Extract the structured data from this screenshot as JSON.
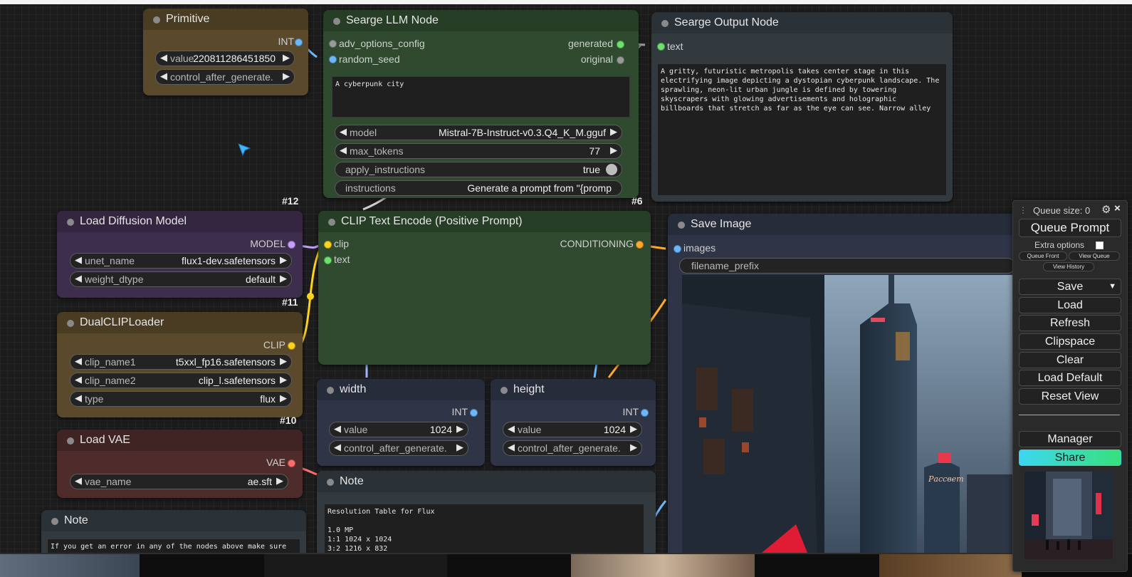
{
  "nodes": {
    "primitive": {
      "title": "Primitive",
      "output": "INT",
      "widgets": [
        {
          "label": "value",
          "value": "220811286451850"
        },
        {
          "label": "control_after_generate.",
          "value": ""
        }
      ]
    },
    "llm": {
      "title": "Searge LLM Node",
      "id": "#6",
      "inputs": [
        "adv_options_config",
        "random_seed"
      ],
      "outputs": [
        "generated",
        "original"
      ],
      "prompt_text": "A cyberpunk city",
      "widgets": [
        {
          "label": "model",
          "value": "Mistral-7B-Instruct-v0.3.Q4_K_M.gguf"
        },
        {
          "label": "max_tokens",
          "value": "77"
        },
        {
          "label": "apply_instructions",
          "value": "true"
        },
        {
          "label": "instructions",
          "value": "Generate a prompt from \"{promp"
        }
      ]
    },
    "output": {
      "title": "Searge Output Node",
      "input": "text",
      "text": "A gritty, futuristic metropolis takes center stage in this electrifying image depicting a dystopian cyberpunk landscape. The sprawling, neon-lit urban jungle is defined by towering skyscrapers with glowing advertisements and holographic billboards that stretch as far as the eye can see. Narrow alley"
    },
    "load_diffusion": {
      "title": "Load Diffusion Model",
      "id": "#12",
      "output": "MODEL",
      "widgets": [
        {
          "label": "unet_name",
          "value": "flux1-dev.safetensors"
        },
        {
          "label": "weight_dtype",
          "value": "default"
        }
      ]
    },
    "dualclip": {
      "title": "DualCLIPLoader",
      "id": "#11",
      "output": "CLIP",
      "widgets": [
        {
          "label": "clip_name1",
          "value": "t5xxl_fp16.safetensors"
        },
        {
          "label": "clip_name2",
          "value": "clip_l.safetensors"
        },
        {
          "label": "type",
          "value": "flux"
        }
      ]
    },
    "loadvae": {
      "title": "Load VAE",
      "id": "#10",
      "output": "VAE",
      "widgets": [
        {
          "label": "vae_name",
          "value": "ae.sft"
        }
      ]
    },
    "note_left": {
      "title": "Note",
      "text": "If you get an error in any of the nodes above make sure"
    },
    "clip_encode": {
      "title": "CLIP Text Encode (Positive Prompt)",
      "inputs": [
        "clip",
        "text"
      ],
      "output": "CONDITIONING"
    },
    "width": {
      "title": "width",
      "output": "INT",
      "widgets": [
        {
          "label": "value",
          "value": "1024"
        },
        {
          "label": "control_after_generate.",
          "value": ""
        }
      ]
    },
    "height": {
      "title": "height",
      "output": "INT",
      "widgets": [
        {
          "label": "value",
          "value": "1024"
        },
        {
          "label": "control_after_generate.",
          "value": ""
        }
      ]
    },
    "note_mid": {
      "title": "Note",
      "text": "Resolution Table for Flux\n\n1.0 MP\n1:1 1024 x 1024\n3:2 1216 x 832"
    },
    "save_image": {
      "title": "Save Image",
      "input": "images",
      "widget": "filename_prefix"
    }
  },
  "queue_panel": {
    "queue_size": "Queue size: 0",
    "queue_prompt": "Queue Prompt",
    "extra_options": "Extra options",
    "queue_front": "Queue Front",
    "view_queue": "View Queue",
    "view_history": "View History",
    "save": "Save",
    "save_dropdown": "▼",
    "load": "Load",
    "refresh": "Refresh",
    "clipspace": "Clipspace",
    "clear": "Clear",
    "load_default": "Load Default",
    "reset_view": "Reset View",
    "manager": "Manager",
    "share": "Share"
  },
  "colors": {
    "green_node": "#2f4a2f",
    "purple_node": "#3e2e4d",
    "brown_node": "#5a4a2b",
    "red_node": "#4e2c2c",
    "blue_node": "#2f3547",
    "gray_node": "#323a40",
    "share_gradient_start": "#3cd7f0",
    "share_gradient_end": "#38e07c"
  }
}
